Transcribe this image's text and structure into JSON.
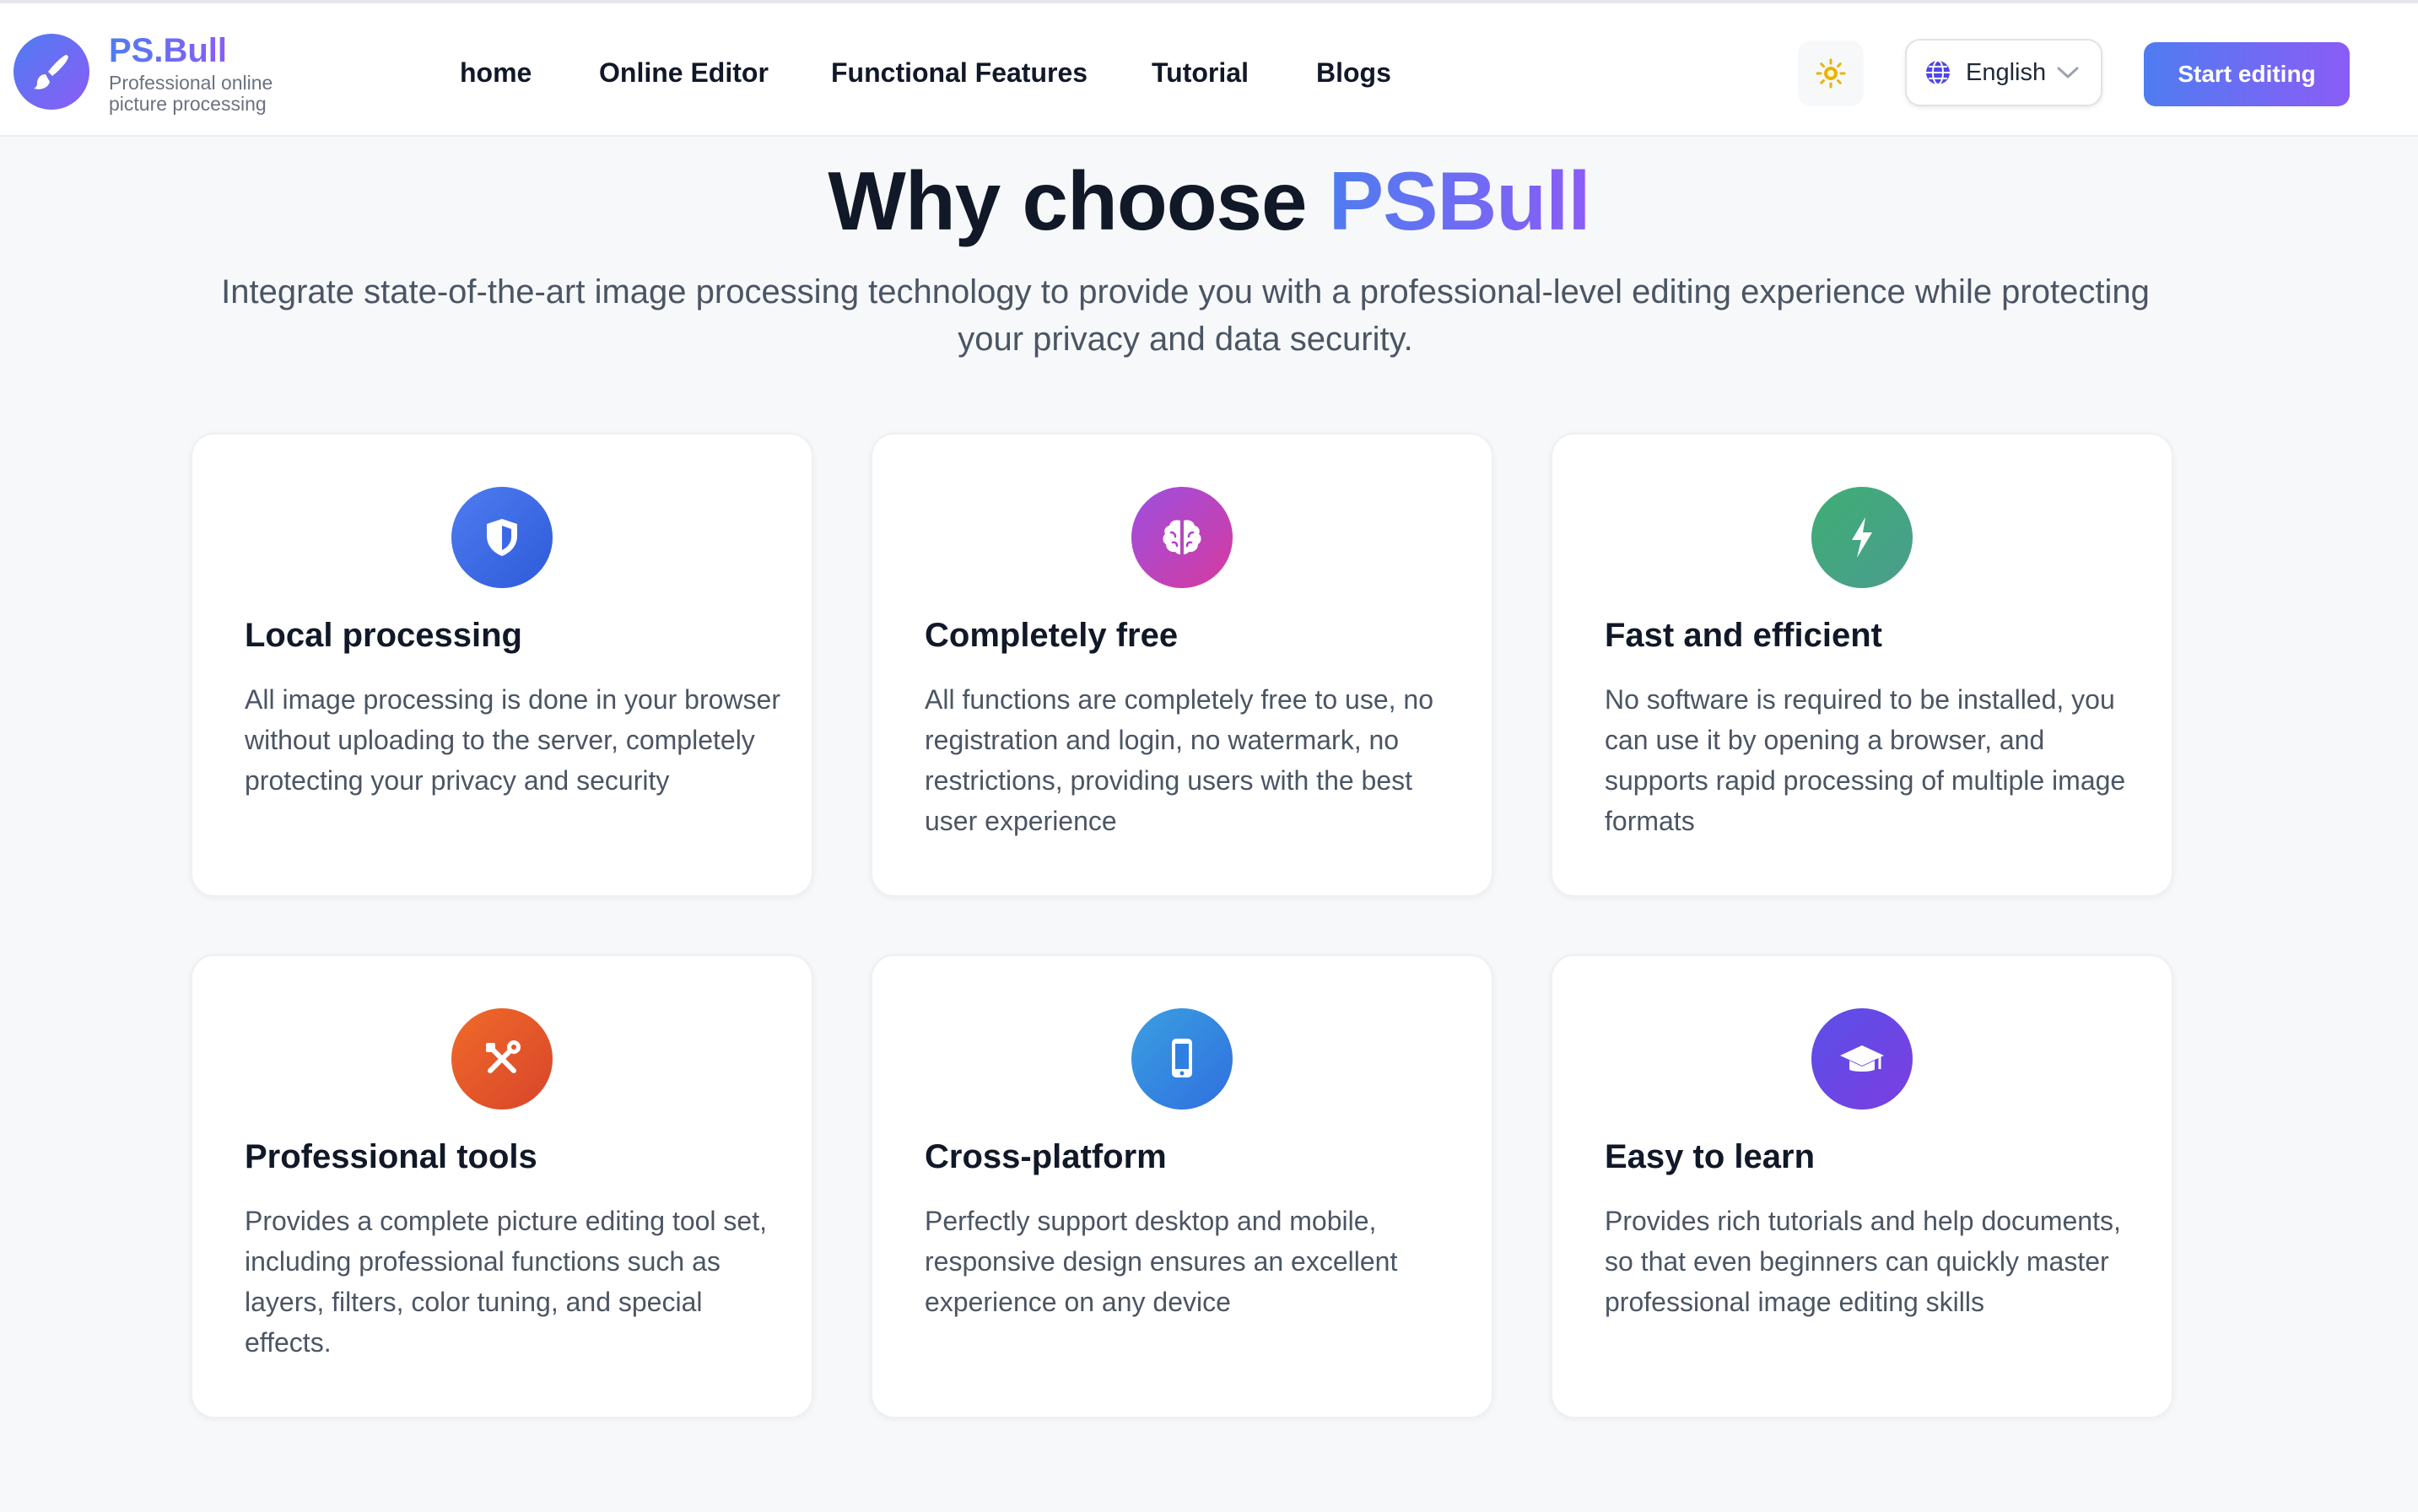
{
  "header": {
    "brand_name": "PS.Bull",
    "brand_tagline": "Professional online picture processing",
    "nav": [
      {
        "label": "home"
      },
      {
        "label": "Online Editor"
      },
      {
        "label": "Functional Features"
      },
      {
        "label": "Tutorial"
      },
      {
        "label": "Blogs"
      }
    ],
    "language": "English",
    "cta_label": "Start editing"
  },
  "hero": {
    "title_prefix": "Why choose",
    "title_accent": "PSBull",
    "subtitle": "Integrate state-of-the-art image processing technology to provide you with a professional-level editing experience while protecting your privacy and data security."
  },
  "features": [
    {
      "title": "Local processing",
      "description": "All image processing is done in your browser without uploading to the server, completely protecting your privacy and security",
      "icon": "shield-icon",
      "color": "#3b6ae8"
    },
    {
      "title": "Completely free",
      "description": "All functions are completely free to use, no registration and login, no watermark, no restrictions, providing users with the best user experience",
      "icon": "brain-icon",
      "color": "#b43fd0"
    },
    {
      "title": "Fast and efficient",
      "description": "No software is required to be installed, you can use it by opening a browser, and supports rapid processing of multiple image formats",
      "icon": "lightning-icon",
      "color": "#3ea278"
    },
    {
      "title": "Professional tools",
      "description": "Provides a complete picture editing tool set, including professional functions such as layers, filters, color tuning, and special effects.",
      "icon": "tools-icon",
      "color": "#e3532a"
    },
    {
      "title": "Cross-platform",
      "description": "Perfectly support desktop and mobile, responsive design ensures an excellent experience on any device",
      "icon": "mobile-icon",
      "color": "#2f80e0"
    },
    {
      "title": "Easy to learn",
      "description": "Provides rich tutorials and help documents, so that even beginners can quickly master professional image editing skills",
      "icon": "graduation-cap-icon",
      "color": "#6b3ee0"
    }
  ]
}
